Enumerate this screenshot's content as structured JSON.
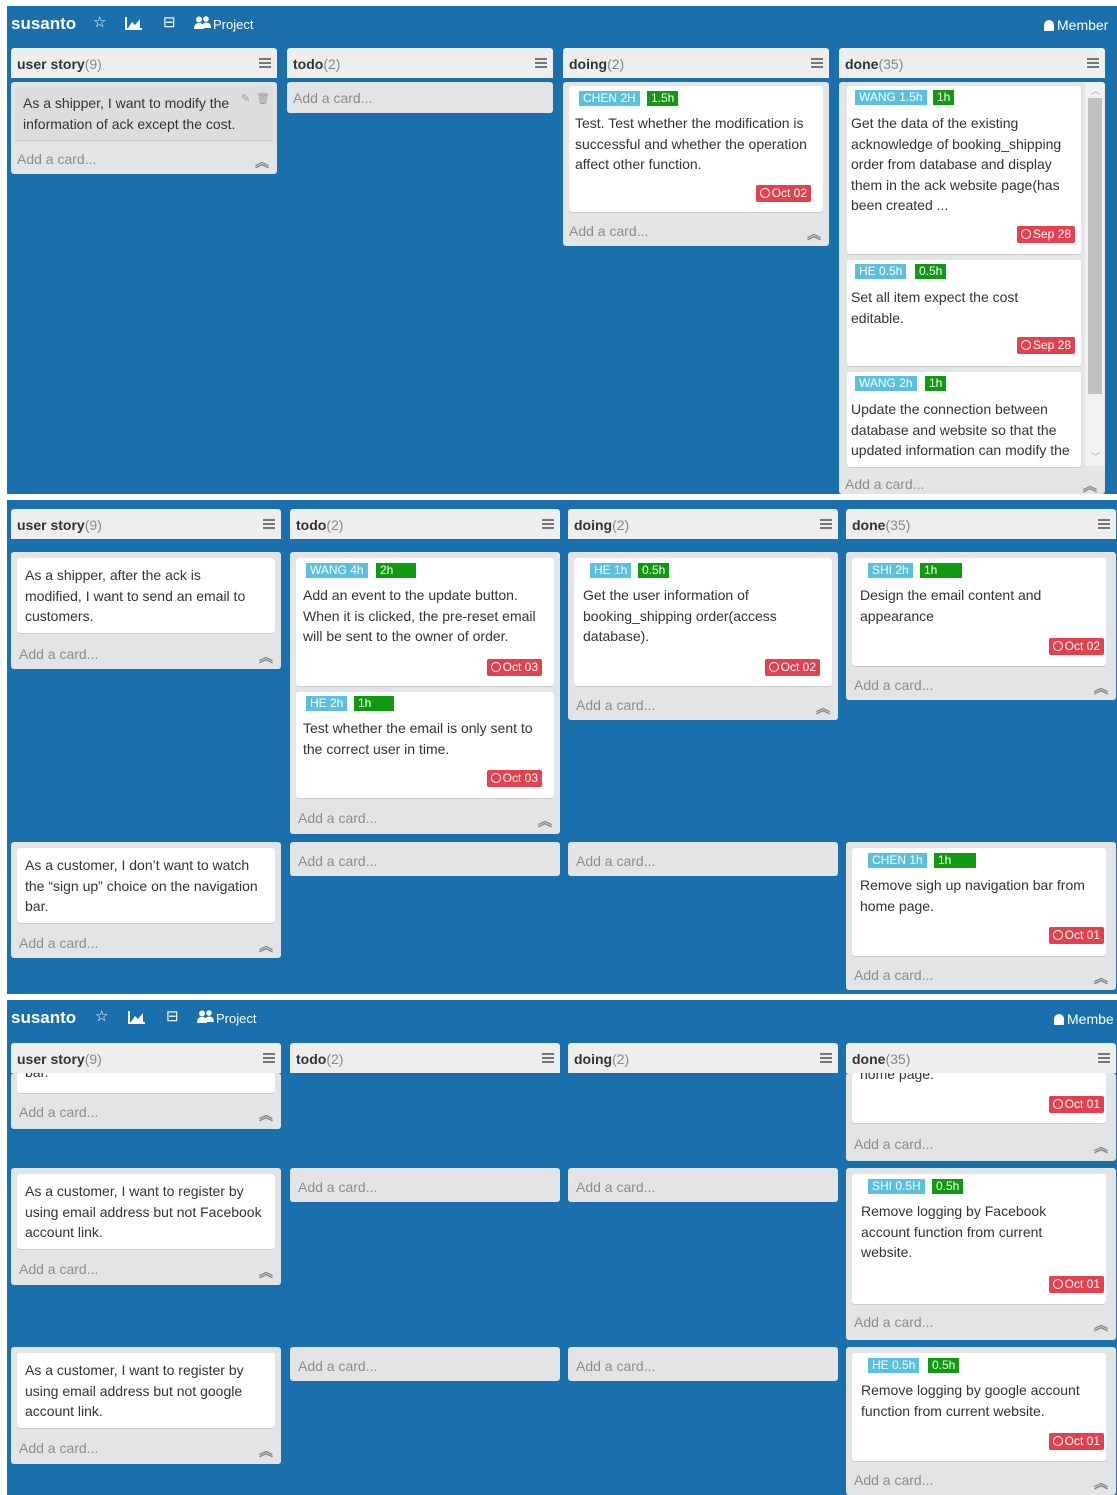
{
  "topbar": {
    "brand": "susanto",
    "star_icon": "☆",
    "board_icon": "⊟",
    "project_label": "Project",
    "member_label": "Member",
    "member_label_cut": "Membe"
  },
  "columns": {
    "user_story": {
      "name": "user story",
      "count": "(9)"
    },
    "todo": {
      "name": "todo",
      "count": "(2)"
    },
    "doing": {
      "name": "doing",
      "count": "(2)"
    },
    "done": {
      "name": "done",
      "count": "(35)"
    }
  },
  "add_card": "Add a card...",
  "panel1": {
    "user_story": {
      "text": "As a shipper, I want to modify the information of ack except the cost."
    },
    "doing": {
      "name_badge": "CHEN 2H",
      "time_badge": "1.5h",
      "text": "Test. Test whether the modification is successful and whether the operation affect other function.",
      "due": "Oct 02"
    },
    "done": [
      {
        "name_badge": "WANG 1.5h",
        "time_badge": "1h",
        "text": "Get the data of the existing acknowledge of booking_shipping order from database and display them in the ack website page(has been created ...",
        "due": "Sep 28"
      },
      {
        "name_badge": "HE 0.5h",
        "time_badge": "0.5h",
        "text": "Set all item expect the cost editable.",
        "due": "Sep 28"
      },
      {
        "name_badge": "WANG 2h",
        "time_badge": "1h",
        "text": "Update the connection between database and website so that the updated information can modify the"
      }
    ]
  },
  "panel2": {
    "row1": {
      "user_story": {
        "text": "As a shipper, after the ack is modified, I want to send an email to customers."
      },
      "todo": [
        {
          "name_badge": "WANG 4h",
          "time_badge": "2h",
          "text": "Add an event to the update button. When it is clicked, the pre-reset email will be sent to the owner of order.",
          "due": "Oct 03"
        },
        {
          "name_badge": "HE 2h",
          "time_badge": "1h",
          "text": "Test whether the email is only sent to the correct user in time.",
          "due": "Oct 03"
        }
      ],
      "doing": {
        "name_badge": "HE 1h",
        "time_badge": "0.5h",
        "text": "Get the user information of booking_shipping order(access database).",
        "due": "Oct 02"
      },
      "done": {
        "name_badge": "SHI 2h",
        "time_badge": "1h",
        "text": "Design the email content and appearance",
        "due": "Oct 02"
      }
    },
    "row2": {
      "user_story": {
        "text": "As a customer, I don’t want to watch the “sign up” choice on the navigation bar."
      },
      "done": {
        "name_badge": "CHEN 1h",
        "time_badge": "1h",
        "text": "Remove sigh up navigation bar from home page.",
        "due": "Oct 01"
      }
    }
  },
  "panel3": {
    "row1": {
      "user_story_cut": "bar.",
      "done_cut": "home page.",
      "done_due": "Oct 01"
    },
    "row2": {
      "user_story": {
        "text": "As a customer, I want to register by using email address but not Facebook account link."
      },
      "done": {
        "name_badge": "SHI 0.5H",
        "time_badge": "0.5h",
        "text": "Remove logging by Facebook account function from current website.",
        "due": "Oct 01"
      }
    },
    "row3": {
      "user_story": {
        "text": "As a customer, I want to register by using email address but not google account link."
      },
      "done": {
        "name_badge": "HE 0.5h",
        "time_badge": "0.5h",
        "text": "Remove logging by google account function from current website.",
        "due": "Oct 01"
      }
    }
  }
}
